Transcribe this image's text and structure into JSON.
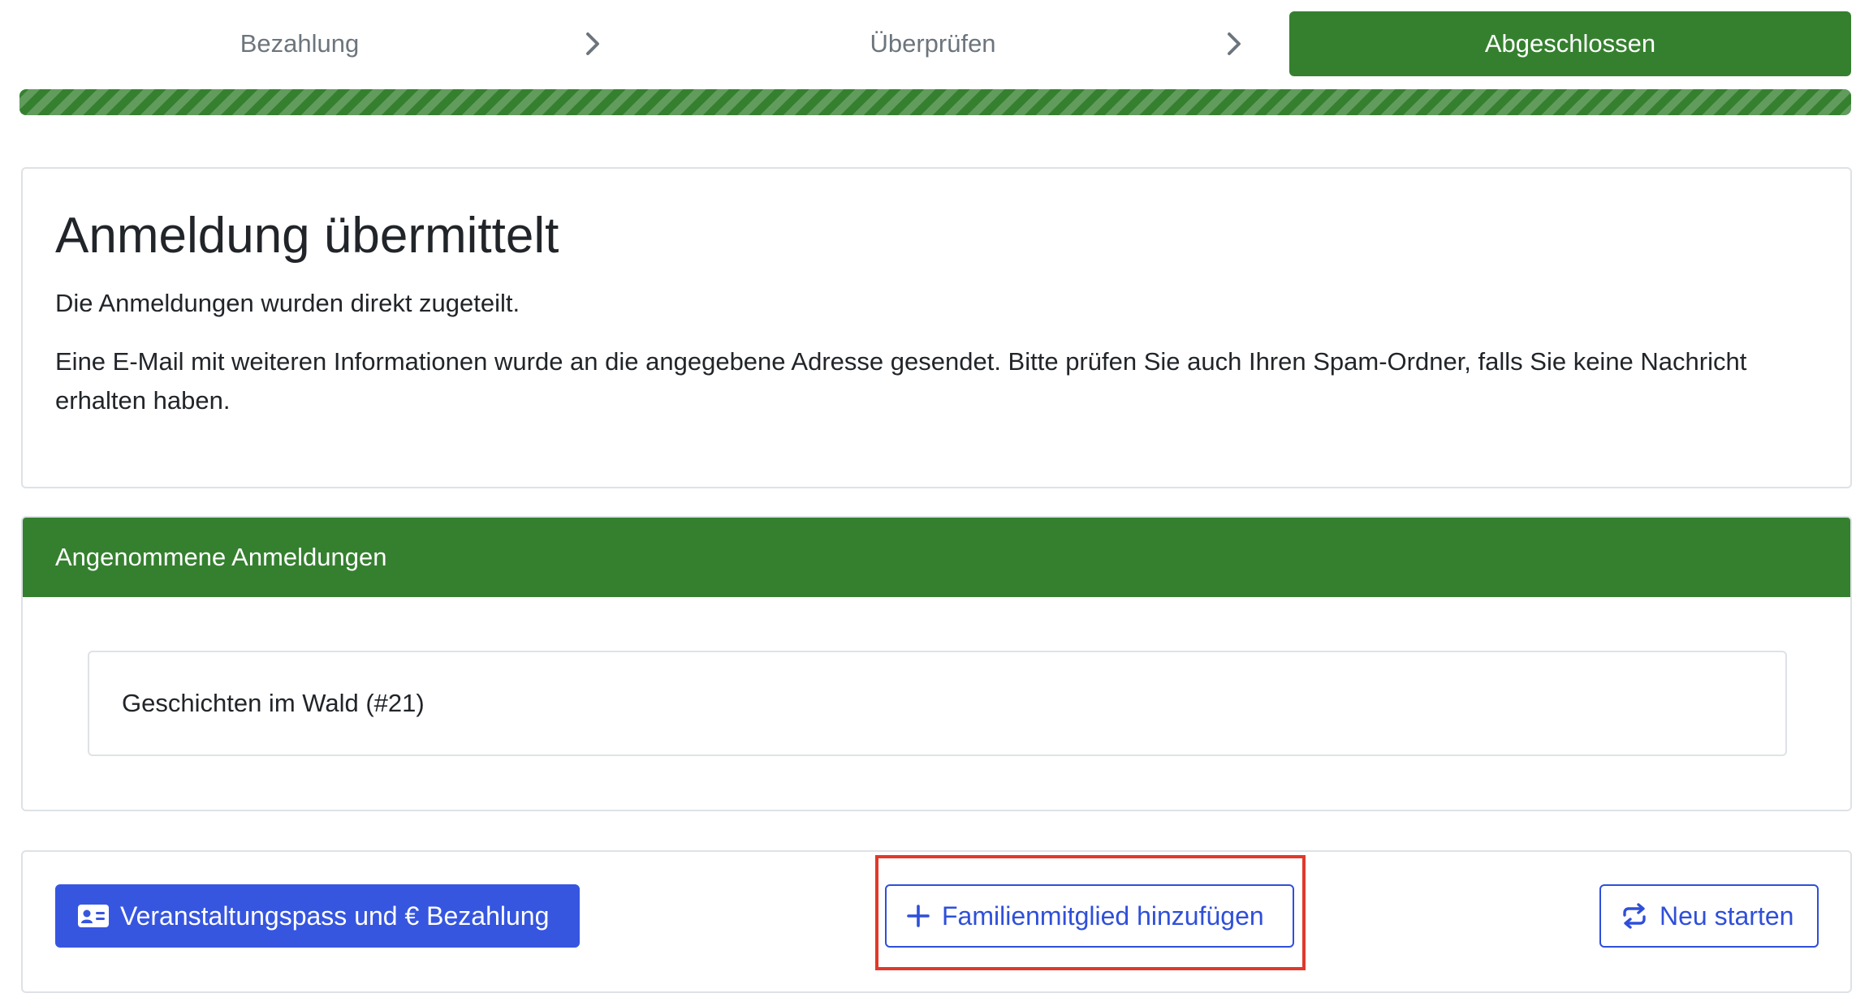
{
  "stepper": {
    "steps": [
      {
        "label": "Bezahlung",
        "state": "done"
      },
      {
        "label": "Überprüfen",
        "state": "done"
      },
      {
        "label": "Abgeschlossen",
        "state": "active"
      }
    ],
    "progress_percent": 100
  },
  "success_card": {
    "title": "Anmeldung übermittelt",
    "line1": "Die Anmeldungen wurden direkt zugeteilt.",
    "line2": "Eine E-Mail mit weiteren Informationen wurde an die angegebene Adresse gesendet. Bitte prüfen Sie auch Ihren Spam-Ordner, falls Sie keine Nachricht erhalten haben."
  },
  "accepted_card": {
    "header": "Angenommene Anmeldungen",
    "items": [
      {
        "label": "Geschichten im Wald (#21)"
      }
    ]
  },
  "actions": {
    "pass_payment_label": "Veranstaltungspass und € Bezahlung",
    "add_family_label": "Familienmitglied hinzufügen",
    "restart_label": "Neu starten"
  },
  "icons": {
    "chevron": "chevron-right-icon",
    "pass": "id-card-icon",
    "add": "plus-icon",
    "restart": "repeat-icon"
  },
  "colors": {
    "success_green": "#35802f",
    "primary_blue": "#3656e0",
    "highlight_red": "#e0392b"
  }
}
